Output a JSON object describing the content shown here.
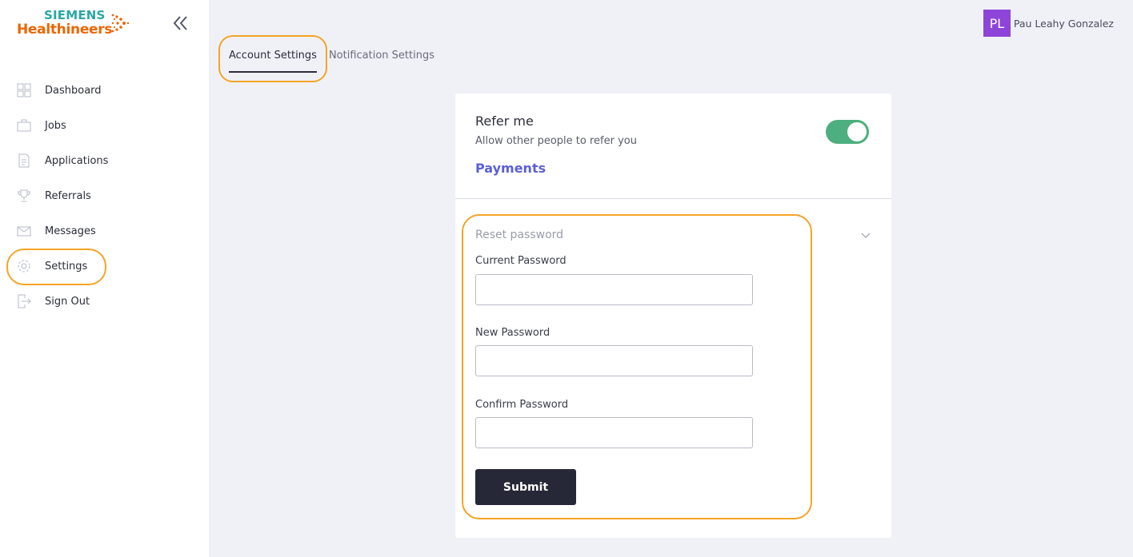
{
  "brand": {
    "line1": "SIEMENS",
    "line2": "Healthineers",
    "teal": "#2aa7a2",
    "orange": "#ec6602"
  },
  "sidebar": {
    "items": [
      {
        "label": "Dashboard",
        "icon": "dashboard-icon"
      },
      {
        "label": "Jobs",
        "icon": "briefcase-icon"
      },
      {
        "label": "Applications",
        "icon": "document-icon"
      },
      {
        "label": "Referrals",
        "icon": "trophy-icon"
      },
      {
        "label": "Messages",
        "icon": "envelope-icon"
      },
      {
        "label": "Settings",
        "icon": "gear-icon"
      },
      {
        "label": "Sign Out",
        "icon": "sign-out-icon"
      }
    ]
  },
  "user": {
    "initials": "PL",
    "name": "Pau Leahy Gonzalez",
    "avatar_color": "#8e44d8"
  },
  "tabs": [
    {
      "label": "Account Settings",
      "active": true
    },
    {
      "label": "Notification Settings",
      "active": false
    }
  ],
  "refer": {
    "title": "Refer me",
    "description": "Allow other people to refer you",
    "enabled": true
  },
  "payments": {
    "label": "Payments"
  },
  "reset": {
    "title": "Reset password",
    "current_label": "Current Password",
    "current_value": "",
    "new_label": "New Password",
    "new_value": "",
    "confirm_label": "Confirm Password",
    "confirm_value": "",
    "submit_label": "Submit"
  },
  "colors": {
    "highlight": "#f5a425",
    "toggle_on": "#4caf7d",
    "accent": "#5b5fd6",
    "button": "#262837"
  }
}
